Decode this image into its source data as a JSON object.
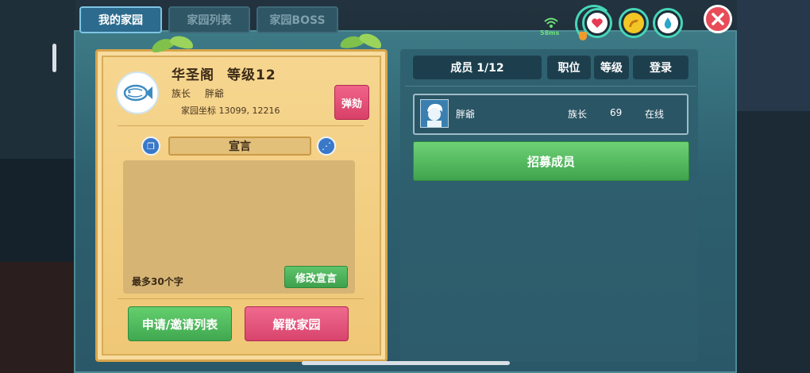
{
  "tabs": [
    {
      "label": "我的家园"
    },
    {
      "label": "家园列表"
    },
    {
      "label": "家园BOSS"
    }
  ],
  "home": {
    "name": "华圣阁",
    "level": "等级12",
    "role_label": "族长",
    "role_name": "胖爺",
    "coord": "家园坐标 13099, 12216",
    "impeach_label": "弹劾"
  },
  "manifesto": {
    "title": "宣言",
    "hint": "最多30个字",
    "edit_label": "修改宣言"
  },
  "actions": {
    "apply_list": "申请/邀请列表",
    "disband": "解散家园"
  },
  "members": {
    "header": "成员 1/12",
    "col_position": "职位",
    "col_level": "等级",
    "col_login": "登录",
    "rows": [
      {
        "name": "胖爺",
        "role": "族长",
        "level": "69",
        "status": "在线"
      }
    ],
    "recruit_label": "招募成员"
  },
  "hud": {
    "ping": "58ms"
  },
  "colors": {
    "accent_green": "#40a850",
    "accent_pink": "#d8446c",
    "stat_ring": "#47d6b8",
    "ping_green": "#6fe07a"
  }
}
